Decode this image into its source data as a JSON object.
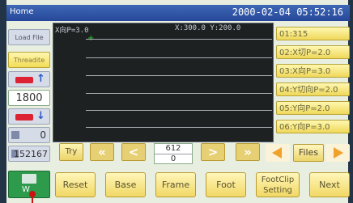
{
  "titlebar": {
    "app_title": "Home",
    "datetime": "2000-02-04 05:52:16"
  },
  "left": {
    "tile1_label": "Load File",
    "tile2_label": "Threadite",
    "speed_value": "1800",
    "counter_value": "0",
    "total_value": "152167"
  },
  "view": {
    "header_left": "X向P=3.0",
    "header_right": "X:300.0  Y:200.0"
  },
  "params": [
    "01:315",
    "02:X切P=2.0",
    "03:X向P=3.0",
    "04:Y切向P=2.0",
    "05:Y向P=2.0",
    "06:Y向P=3.0"
  ],
  "nav": {
    "try": "Try",
    "stitch_top": "612",
    "stitch_bottom": "0",
    "files": "Files"
  },
  "bottom": {
    "home_label": "W",
    "reset": "Reset",
    "base": "Base",
    "frame": "Frame",
    "foot": "Foot",
    "footclip_line1": "FootClip",
    "footclip_line2": "Setting",
    "next": "Next"
  },
  "colors": {
    "titlebar": "#2c4fa3",
    "button_yellow": "#f2dd55",
    "view_bg": "#1e2122"
  }
}
